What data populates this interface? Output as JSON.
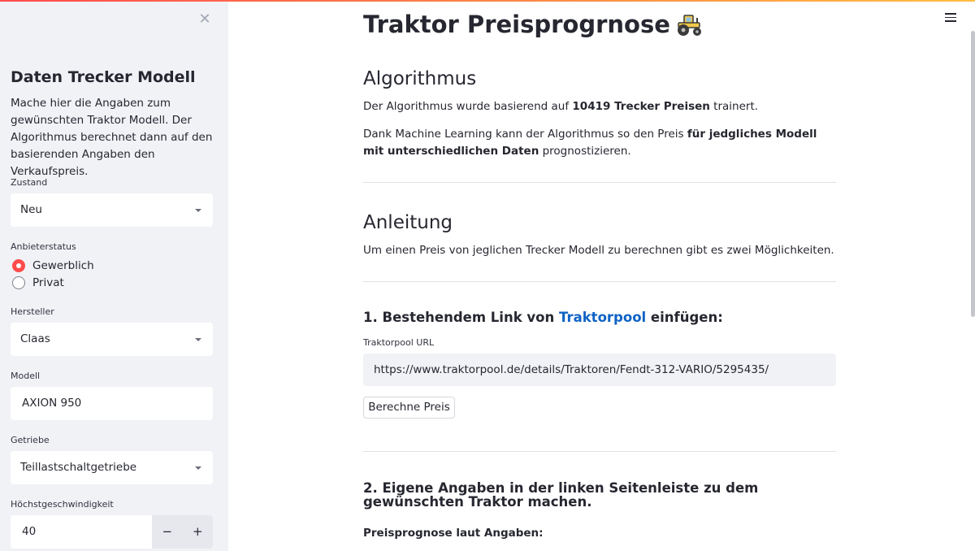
{
  "colors": {
    "accent": "#ff4b4b",
    "link": "#0f63c5",
    "sidebar_bg": "#f0f2f6"
  },
  "sidebar": {
    "close_icon": "close-icon",
    "title": "Daten Trecker Modell",
    "description": "Mache hier die Angaben zum gewünschten Traktor Modell. Der Algorithmus berechnet dann auf den basierenden Angaben den Verkaufspreis.",
    "zustand": {
      "label": "Zustand",
      "value": "Neu"
    },
    "anbieterstatus": {
      "label": "Anbieterstatus",
      "options": [
        {
          "label": "Gewerblich",
          "selected": true
        },
        {
          "label": "Privat",
          "selected": false
        }
      ]
    },
    "hersteller": {
      "label": "Hersteller",
      "value": "Claas"
    },
    "modell": {
      "label": "Modell",
      "value": "AXION 950"
    },
    "getriebe": {
      "label": "Getriebe",
      "value": "Teillastschaltgetriebe"
    },
    "hoechstgeschwindigkeit": {
      "label": "Höchstgeschwindigkeit",
      "value": "40",
      "minus": "−",
      "plus": "+"
    }
  },
  "main": {
    "title": "Traktor Preisprogrnose",
    "title_icon": "tractor-icon",
    "menu_icon": "hamburger-menu-icon",
    "algorithmus": {
      "heading": "Algorithmus",
      "p1_a": "Der Algorithmus wurde basierend auf ",
      "p1_b": "10419 Trecker Preisen",
      "p1_c": " trainert.",
      "p2_a": "Dank Machine Learning kann der Algorithmus so den Preis ",
      "p2_b": "für jedgliches Modell mit unterschiedlichen Daten",
      "p2_c": " prognostizieren."
    },
    "anleitung": {
      "heading": "Anleitung",
      "text": "Um einen Preis von jeglichen Trecker Modell zu berechnen gibt es zwei Möglichkeiten."
    },
    "step1": {
      "heading_a": "1. Bestehendem Link von ",
      "heading_link": "Traktorpool",
      "heading_b": " einfügen:",
      "url_label": "Traktorpool URL",
      "url_value": "https://www.traktorpool.de/details/Traktoren/Fendt-312-VARIO/5295435/",
      "button": "Berechne Preis"
    },
    "step2": {
      "heading_a": "2. Eigene Angaben ",
      "heading_b": "in der linken Seitenleiste",
      "heading_c": " zu dem gewünschten Traktor machen.",
      "result_label": "Preisprognose laut Angaben:"
    }
  }
}
